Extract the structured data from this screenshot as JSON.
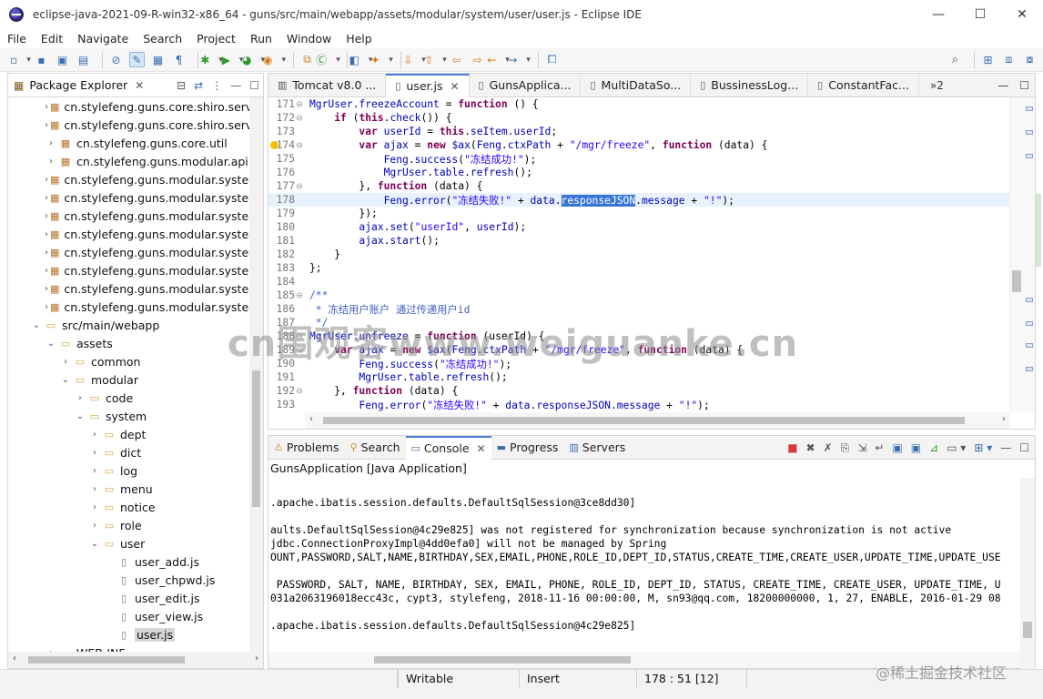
{
  "window": {
    "title": "eclipse-java-2021-09-R-win32-x86_64 - guns/src/main/webapp/assets/modular/system/user/user.js - Eclipse IDE",
    "controls": [
      "—",
      "☐",
      "✕"
    ]
  },
  "menu": [
    "File",
    "Edit",
    "Navigate",
    "Search",
    "Project",
    "Run",
    "Window",
    "Help"
  ],
  "package_explorer": {
    "title": "Package Explorer",
    "tree": [
      {
        "indent": 2,
        "arrow": "›",
        "icon": "pkg",
        "label": "cn.stylefeng.guns.core.shiro.servi"
      },
      {
        "indent": 2,
        "arrow": "›",
        "icon": "pkg",
        "label": "cn.stylefeng.guns.core.shiro.servi"
      },
      {
        "indent": 2,
        "arrow": "›",
        "icon": "pkg",
        "label": "cn.stylefeng.guns.core.util"
      },
      {
        "indent": 2,
        "arrow": "›",
        "icon": "pkg",
        "label": "cn.stylefeng.guns.modular.api"
      },
      {
        "indent": 2,
        "arrow": "›",
        "icon": "pkg",
        "label": "cn.stylefeng.guns.modular.system"
      },
      {
        "indent": 2,
        "arrow": "›",
        "icon": "pkg",
        "label": "cn.stylefeng.guns.modular.system"
      },
      {
        "indent": 2,
        "arrow": "›",
        "icon": "pkg",
        "label": "cn.stylefeng.guns.modular.system"
      },
      {
        "indent": 2,
        "arrow": "›",
        "icon": "pkg",
        "label": "cn.stylefeng.guns.modular.system"
      },
      {
        "indent": 2,
        "arrow": "›",
        "icon": "pkg",
        "label": "cn.stylefeng.guns.modular.system"
      },
      {
        "indent": 2,
        "arrow": "›",
        "icon": "pkg",
        "label": "cn.stylefeng.guns.modular.system"
      },
      {
        "indent": 2,
        "arrow": "›",
        "icon": "pkg",
        "label": "cn.stylefeng.guns.modular.system"
      },
      {
        "indent": 2,
        "arrow": "›",
        "icon": "pkg",
        "label": "cn.stylefeng.guns.modular.system"
      },
      {
        "indent": 1,
        "arrow": "⌄",
        "icon": "folder",
        "label": "src/main/webapp"
      },
      {
        "indent": 2,
        "arrow": "⌄",
        "icon": "folder",
        "label": "assets"
      },
      {
        "indent": 3,
        "arrow": "›",
        "icon": "folder",
        "label": "common"
      },
      {
        "indent": 3,
        "arrow": "⌄",
        "icon": "folder",
        "label": "modular"
      },
      {
        "indent": 4,
        "arrow": "›",
        "icon": "folder",
        "label": "code"
      },
      {
        "indent": 4,
        "arrow": "⌄",
        "icon": "folder",
        "label": "system"
      },
      {
        "indent": 5,
        "arrow": "›",
        "icon": "folder",
        "label": "dept"
      },
      {
        "indent": 5,
        "arrow": "›",
        "icon": "folder",
        "label": "dict"
      },
      {
        "indent": 5,
        "arrow": "›",
        "icon": "folder",
        "label": "log"
      },
      {
        "indent": 5,
        "arrow": "›",
        "icon": "folder",
        "label": "menu"
      },
      {
        "indent": 5,
        "arrow": "›",
        "icon": "folder",
        "label": "notice"
      },
      {
        "indent": 5,
        "arrow": "›",
        "icon": "folder",
        "label": "role"
      },
      {
        "indent": 5,
        "arrow": "⌄",
        "icon": "folder",
        "label": "user"
      },
      {
        "indent": 6,
        "arrow": "",
        "icon": "file",
        "label": "user_add.js"
      },
      {
        "indent": 6,
        "arrow": "",
        "icon": "file",
        "label": "user_chpwd.js"
      },
      {
        "indent": 6,
        "arrow": "",
        "icon": "file",
        "label": "user_edit.js"
      },
      {
        "indent": 6,
        "arrow": "",
        "icon": "file",
        "label": "user_view.js"
      },
      {
        "indent": 6,
        "arrow": "",
        "icon": "file",
        "label": "user.js",
        "selected": true
      },
      {
        "indent": 2,
        "arrow": "›",
        "icon": "folder",
        "label": "WEB-INF"
      }
    ]
  },
  "editor": {
    "tabs": [
      {
        "label": "Tomcat v8.0 ...",
        "icon": "server"
      },
      {
        "label": "user.js",
        "icon": "js",
        "active": true
      },
      {
        "label": "GunsApplica...",
        "icon": "java"
      },
      {
        "label": "MultiDataSo...",
        "icon": "java"
      },
      {
        "label": "BussinessLog...",
        "icon": "java"
      },
      {
        "label": "ConstantFac...",
        "icon": "java"
      }
    ],
    "overflow_label": "»2",
    "lines": [
      {
        "n": "171",
        "fold": "⊖",
        "tokens": [
          [
            "id",
            "MgrUser"
          ],
          [
            "t",
            "."
          ],
          [
            "id",
            "freezeAccount"
          ],
          [
            "t",
            " = "
          ],
          [
            "kw",
            "function"
          ],
          [
            "t",
            " () {"
          ]
        ]
      },
      {
        "n": "172",
        "fold": "⊖",
        "tokens": [
          [
            "t",
            "    "
          ],
          [
            "kw",
            "if"
          ],
          [
            "t",
            " ("
          ],
          [
            "kw",
            "this"
          ],
          [
            "t",
            "."
          ],
          [
            "id",
            "check"
          ],
          [
            "t",
            "()) {"
          ]
        ]
      },
      {
        "n": "173",
        "fold": "",
        "tokens": [
          [
            "t",
            "        "
          ],
          [
            "kw",
            "var"
          ],
          [
            "t",
            " "
          ],
          [
            "id",
            "userId"
          ],
          [
            "t",
            " = "
          ],
          [
            "kw",
            "this"
          ],
          [
            "t",
            "."
          ],
          [
            "id",
            "seItem"
          ],
          [
            "t",
            "."
          ],
          [
            "id",
            "userId"
          ],
          [
            "t",
            ";"
          ]
        ]
      },
      {
        "n": "174",
        "fold": "⊖",
        "warn": true,
        "tokens": [
          [
            "t",
            "        "
          ],
          [
            "kw",
            "var"
          ],
          [
            "t",
            " "
          ],
          [
            "id",
            "ajax"
          ],
          [
            "t",
            " = "
          ],
          [
            "kw",
            "new"
          ],
          [
            "t",
            " "
          ],
          [
            "id",
            "$ax"
          ],
          [
            "t",
            "("
          ],
          [
            "id",
            "Feng"
          ],
          [
            "t",
            "."
          ],
          [
            "id",
            "ctxPath"
          ],
          [
            "t",
            " + "
          ],
          [
            "str",
            "\"/mgr/freeze\""
          ],
          [
            "t",
            ", "
          ],
          [
            "kw",
            "function"
          ],
          [
            "t",
            " (data) {"
          ]
        ]
      },
      {
        "n": "175",
        "fold": "",
        "tokens": [
          [
            "t",
            "            "
          ],
          [
            "id",
            "Feng"
          ],
          [
            "t",
            "."
          ],
          [
            "id",
            "success"
          ],
          [
            "t",
            "("
          ],
          [
            "str",
            "\"冻结成功!\""
          ],
          [
            "t",
            ");"
          ]
        ]
      },
      {
        "n": "176",
        "fold": "",
        "tokens": [
          [
            "t",
            "            "
          ],
          [
            "id",
            "MgrUser"
          ],
          [
            "t",
            "."
          ],
          [
            "id",
            "table"
          ],
          [
            "t",
            "."
          ],
          [
            "id",
            "refresh"
          ],
          [
            "t",
            "();"
          ]
        ]
      },
      {
        "n": "177",
        "fold": "⊖",
        "tokens": [
          [
            "t",
            "        }, "
          ],
          [
            "kw",
            "function"
          ],
          [
            "t",
            " (data) {"
          ]
        ]
      },
      {
        "n": "178",
        "fold": "",
        "current": true,
        "tokens": [
          [
            "t",
            "            "
          ],
          [
            "id",
            "Feng"
          ],
          [
            "t",
            "."
          ],
          [
            "id",
            "error"
          ],
          [
            "t",
            "("
          ],
          [
            "str",
            "\"冻结失败!\""
          ],
          [
            "t",
            " + "
          ],
          [
            "id",
            "data"
          ],
          [
            "t",
            "."
          ],
          [
            "sel",
            "responseJSON"
          ],
          [
            "t",
            "."
          ],
          [
            "id",
            "message"
          ],
          [
            "t",
            " + "
          ],
          [
            "str",
            "\"!\""
          ],
          [
            "t",
            ");"
          ]
        ]
      },
      {
        "n": "179",
        "fold": "",
        "tokens": [
          [
            "t",
            "        });"
          ]
        ]
      },
      {
        "n": "180",
        "fold": "",
        "tokens": [
          [
            "t",
            "        "
          ],
          [
            "id",
            "ajax"
          ],
          [
            "t",
            "."
          ],
          [
            "id",
            "set"
          ],
          [
            "t",
            "("
          ],
          [
            "str",
            "\"userId\""
          ],
          [
            "t",
            ", "
          ],
          [
            "id",
            "userId"
          ],
          [
            "t",
            ");"
          ]
        ]
      },
      {
        "n": "181",
        "fold": "",
        "tokens": [
          [
            "t",
            "        "
          ],
          [
            "id",
            "ajax"
          ],
          [
            "t",
            "."
          ],
          [
            "id",
            "start"
          ],
          [
            "t",
            "();"
          ]
        ]
      },
      {
        "n": "182",
        "fold": "",
        "tokens": [
          [
            "t",
            "    }"
          ]
        ]
      },
      {
        "n": "183",
        "fold": "",
        "tokens": [
          [
            "t",
            "};"
          ]
        ]
      },
      {
        "n": "184",
        "fold": "",
        "tokens": [
          [
            "t",
            ""
          ]
        ]
      },
      {
        "n": "185",
        "fold": "⊖",
        "tokens": [
          [
            "cm",
            "/**"
          ]
        ]
      },
      {
        "n": "186",
        "fold": "",
        "tokens": [
          [
            "cm",
            " * 冻结用户账户 通过传递用户id"
          ]
        ]
      },
      {
        "n": "187",
        "fold": "",
        "tokens": [
          [
            "cm",
            " */"
          ]
        ]
      },
      {
        "n": "188",
        "fold": "⊖",
        "tokens": [
          [
            "id",
            "MgrUser"
          ],
          [
            "t",
            "."
          ],
          [
            "id",
            "unfreeze"
          ],
          [
            "t",
            " = "
          ],
          [
            "kw",
            "function"
          ],
          [
            "t",
            " (userId) {"
          ]
        ]
      },
      {
        "n": "189",
        "fold": "⊖",
        "tokens": [
          [
            "t",
            "    "
          ],
          [
            "kw",
            "var"
          ],
          [
            "t",
            " "
          ],
          [
            "id",
            "ajax"
          ],
          [
            "t",
            " = "
          ],
          [
            "kw",
            "new"
          ],
          [
            "t",
            " "
          ],
          [
            "id",
            "$ax"
          ],
          [
            "t",
            "("
          ],
          [
            "id",
            "Feng"
          ],
          [
            "t",
            "."
          ],
          [
            "id",
            "ctxPath"
          ],
          [
            "t",
            " + "
          ],
          [
            "str",
            "\"/mgr/freeze\""
          ],
          [
            "t",
            ", "
          ],
          [
            "kw",
            "function"
          ],
          [
            "t",
            " (data) {"
          ]
        ]
      },
      {
        "n": "190",
        "fold": "",
        "tokens": [
          [
            "t",
            "        "
          ],
          [
            "id",
            "Feng"
          ],
          [
            "t",
            "."
          ],
          [
            "id",
            "success"
          ],
          [
            "t",
            "("
          ],
          [
            "str",
            "\"冻结成功!\""
          ],
          [
            "t",
            ");"
          ]
        ]
      },
      {
        "n": "191",
        "fold": "",
        "tokens": [
          [
            "t",
            "        "
          ],
          [
            "id",
            "MgrUser"
          ],
          [
            "t",
            "."
          ],
          [
            "id",
            "table"
          ],
          [
            "t",
            "."
          ],
          [
            "id",
            "refresh"
          ],
          [
            "t",
            "();"
          ]
        ]
      },
      {
        "n": "192",
        "fold": "⊖",
        "tokens": [
          [
            "t",
            "    }, "
          ],
          [
            "kw",
            "function"
          ],
          [
            "t",
            " (data) {"
          ]
        ]
      },
      {
        "n": "193",
        "fold": "",
        "tokens": [
          [
            "t",
            "        "
          ],
          [
            "id",
            "Feng"
          ],
          [
            "t",
            "."
          ],
          [
            "id",
            "error"
          ],
          [
            "t",
            "("
          ],
          [
            "str",
            "\"冻结失败!\""
          ],
          [
            "t",
            " + "
          ],
          [
            "id",
            "data"
          ],
          [
            "t",
            "."
          ],
          [
            "id",
            "responseJSON"
          ],
          [
            "t",
            "."
          ],
          [
            "id",
            "message"
          ],
          [
            "t",
            " + "
          ],
          [
            "str",
            "\"!\""
          ],
          [
            "t",
            ");"
          ]
        ]
      }
    ]
  },
  "console_view": {
    "tabs": [
      {
        "label": "Problems",
        "icon": "problems"
      },
      {
        "label": "Search",
        "icon": "search"
      },
      {
        "label": "Console",
        "icon": "console",
        "active": true
      },
      {
        "label": "Progress",
        "icon": "progress"
      },
      {
        "label": "Servers",
        "icon": "servers"
      }
    ],
    "description": "GunsApplication [Java Application]",
    "lines": [
      "",
      ".apache.ibatis.session.defaults.DefaultSqlSession@3ce8dd30]",
      "",
      "aults.DefaultSqlSession@4c29e825] was not registered for synchronization because synchronization is not active",
      "jdbc.ConnectionProxyImpl@4dd0efa0] will not be managed by Spring",
      "OUNT,PASSWORD,SALT,NAME,BIRTHDAY,SEX,EMAIL,PHONE,ROLE_ID,DEPT_ID,STATUS,CREATE_TIME,CREATE_USER,UPDATE_TIME,UPDATE_USE",
      "",
      " PASSWORD, SALT, NAME, BIRTHDAY, SEX, EMAIL, PHONE, ROLE_ID, DEPT_ID, STATUS, CREATE_TIME, CREATE_USER, UPDATE_TIME, U",
      "031a2063196018ecc43c, cypt3, stylefeng, 2018-11-16 00:00:00, M, sn93@qq.com, 18200000000, 1, 27, ENABLE, 2016-01-29 08",
      "",
      ".apache.ibatis.session.defaults.DefaultSqlSession@4c29e825]"
    ]
  },
  "status": {
    "writable": "Writable",
    "insert": "Insert",
    "position": "178 : 51 [12]"
  },
  "watermark": "cn围观客www.weiguanke.cn",
  "watermark_corner": "@稀土掘金技术社区"
}
